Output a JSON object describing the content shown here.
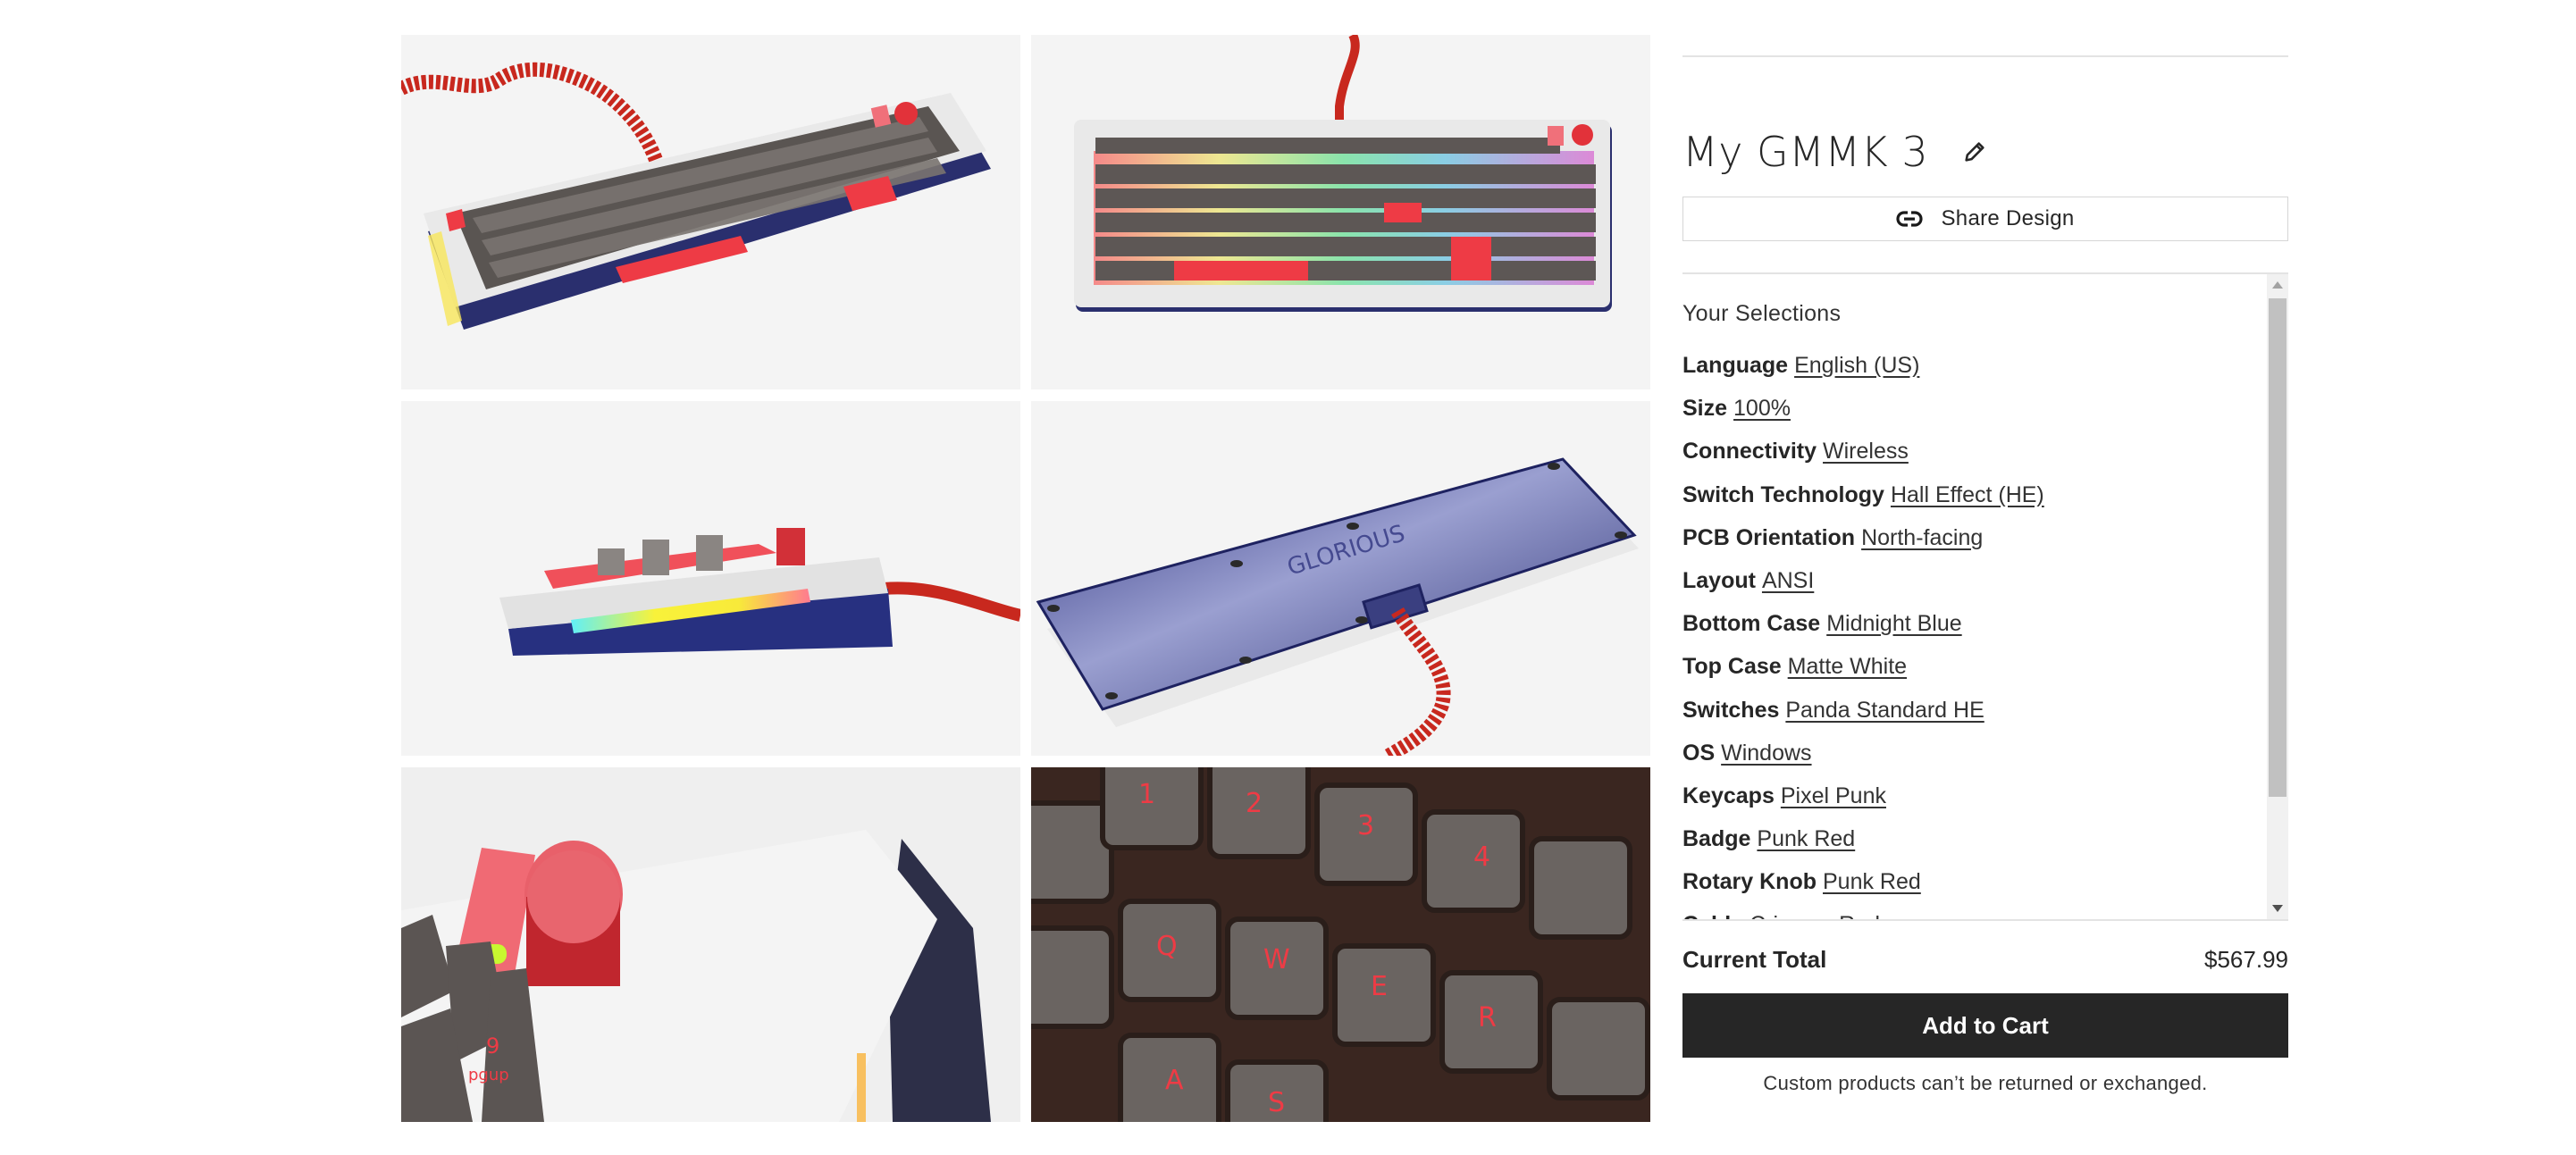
{
  "gallery": {
    "images": [
      {
        "label": "Keyboard three-quarter top view with coiled cable"
      },
      {
        "label": "Keyboard top-down view with RGB lighting"
      },
      {
        "label": "Keyboard side profile with RGB light bar"
      },
      {
        "label": "Keyboard underside bottom case with cable"
      },
      {
        "label": "Close-up of badge and rotary knob"
      },
      {
        "label": "Close-up of Pixel Punk keycaps"
      }
    ]
  },
  "product": {
    "title": "My GMMK 3",
    "edit_icon": "pencil-icon",
    "share_label": "Share Design",
    "share_icon": "link-icon"
  },
  "selections": {
    "heading": "Your Selections",
    "items": [
      {
        "key": "Language",
        "value": "English (US)"
      },
      {
        "key": "Size",
        "value": "100%"
      },
      {
        "key": "Connectivity",
        "value": "Wireless"
      },
      {
        "key": "Switch Technology",
        "value": "Hall Effect (HE)"
      },
      {
        "key": "PCB Orientation",
        "value": "North-facing"
      },
      {
        "key": "Layout",
        "value": "ANSI"
      },
      {
        "key": "Bottom Case",
        "value": "Midnight Blue"
      },
      {
        "key": "Top Case",
        "value": "Matte White"
      },
      {
        "key": "Switches",
        "value": "Panda Standard HE"
      },
      {
        "key": "OS",
        "value": "Windows"
      },
      {
        "key": "Keycaps",
        "value": "Pixel Punk"
      },
      {
        "key": "Badge",
        "value": "Punk Red"
      },
      {
        "key": "Rotary Knob",
        "value": "Punk Red"
      },
      {
        "key": "Cable",
        "value": "Crimson Red"
      }
    ]
  },
  "cart": {
    "total_label": "Current Total",
    "total_value": "$567.99",
    "add_to_cart_label": "Add to Cart",
    "disclaimer": "Custom products can’t be returned or exchanged."
  },
  "colors": {
    "primary_button": "#262626",
    "tile_background": "#f4f4f4",
    "divider": "#e3e3e3"
  }
}
